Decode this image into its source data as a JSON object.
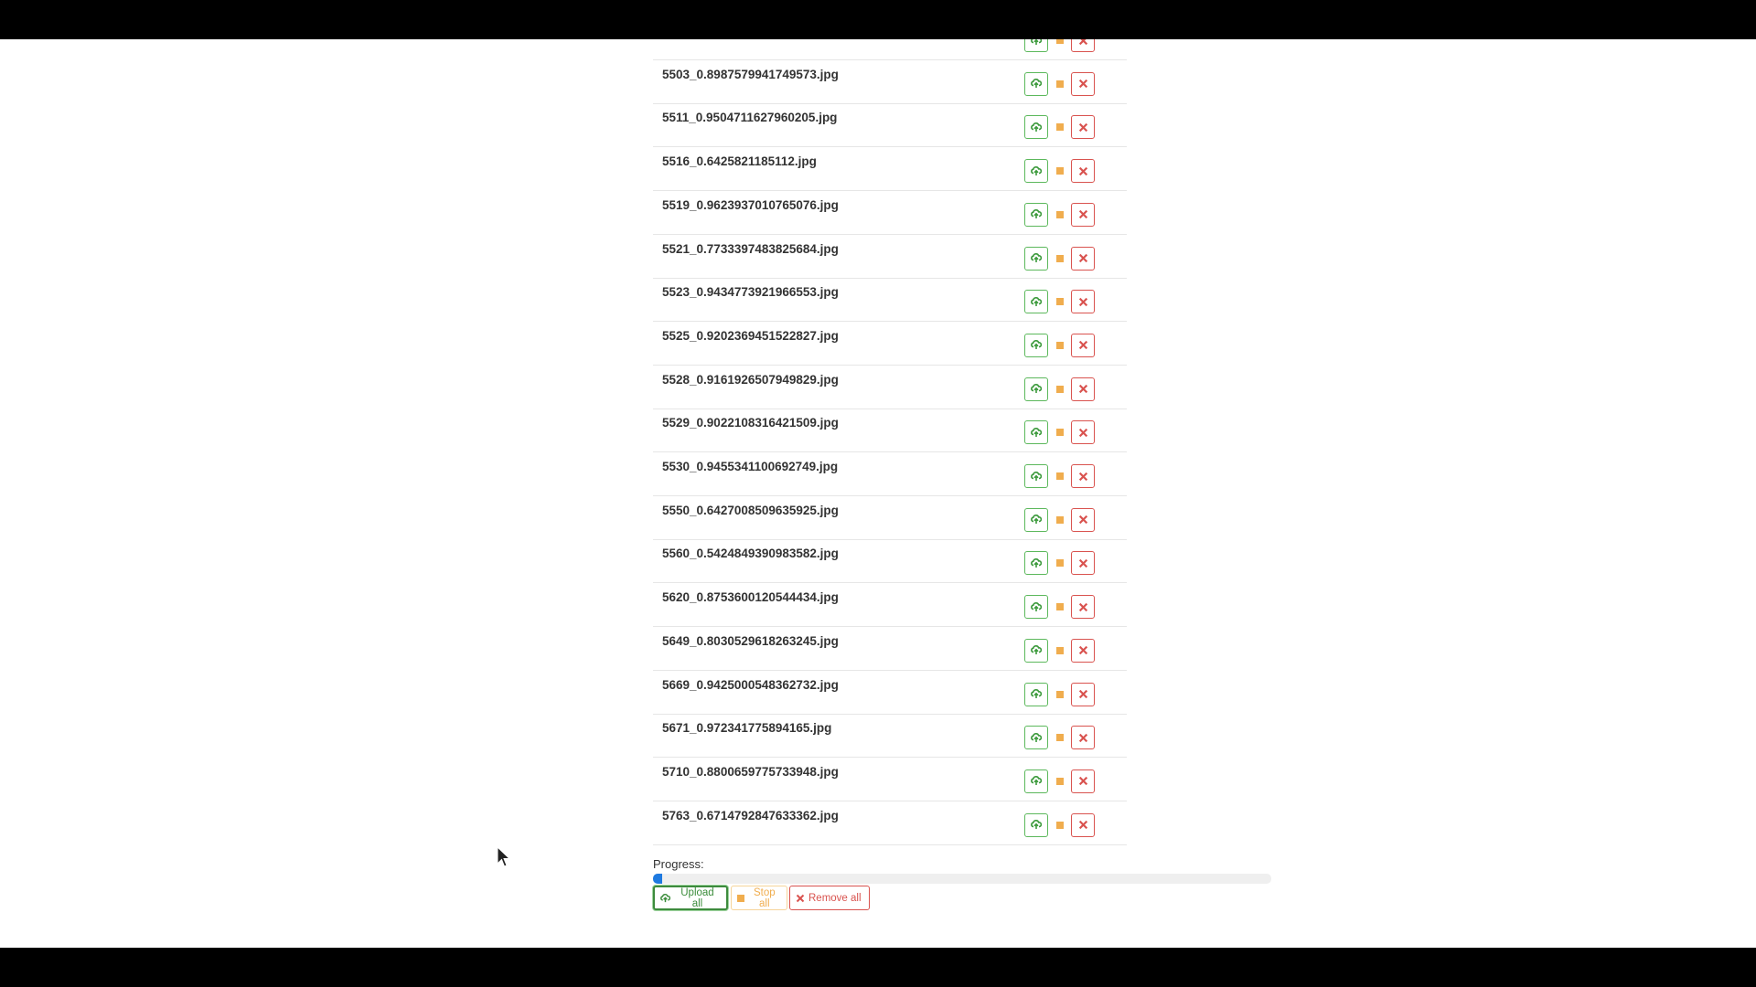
{
  "file_queue": {
    "files": [
      {
        "name": ""
      },
      {
        "name": "5503_0.8987579941749573.jpg"
      },
      {
        "name": "5511_0.9504711627960205.jpg"
      },
      {
        "name": "5516_0.6425821185112.jpg"
      },
      {
        "name": "5519_0.9623937010765076.jpg"
      },
      {
        "name": "5521_0.7733397483825684.jpg"
      },
      {
        "name": "5523_0.9434773921966553.jpg"
      },
      {
        "name": "5525_0.9202369451522827.jpg"
      },
      {
        "name": "5528_0.9161926507949829.jpg"
      },
      {
        "name": "5529_0.9022108316421509.jpg"
      },
      {
        "name": "5530_0.9455341100692749.jpg"
      },
      {
        "name": "5550_0.6427008509635925.jpg"
      },
      {
        "name": "5560_0.5424849390983582.jpg"
      },
      {
        "name": "5620_0.8753600120544434.jpg"
      },
      {
        "name": "5649_0.8030529618263245.jpg"
      },
      {
        "name": "5669_0.9425000548362732.jpg"
      },
      {
        "name": "5671_0.972341775894165.jpg"
      },
      {
        "name": "5710_0.8800659775733948.jpg"
      },
      {
        "name": "5763_0.6714792847633362.jpg"
      }
    ],
    "row_actions": {
      "upload_icon": "cloud-upload-icon",
      "stop_icon": "stop-icon",
      "remove_icon": "close-icon"
    }
  },
  "progress": {
    "label": "Progress:",
    "fraction": 0.015
  },
  "actions": {
    "upload_all": "Upload all",
    "stop_all": "Stop all",
    "remove_all": "Remove all"
  },
  "colors": {
    "success": "#5cb85c",
    "warning": "#f0ad4e",
    "danger": "#d9534f",
    "progress": "#1f7ae0"
  }
}
